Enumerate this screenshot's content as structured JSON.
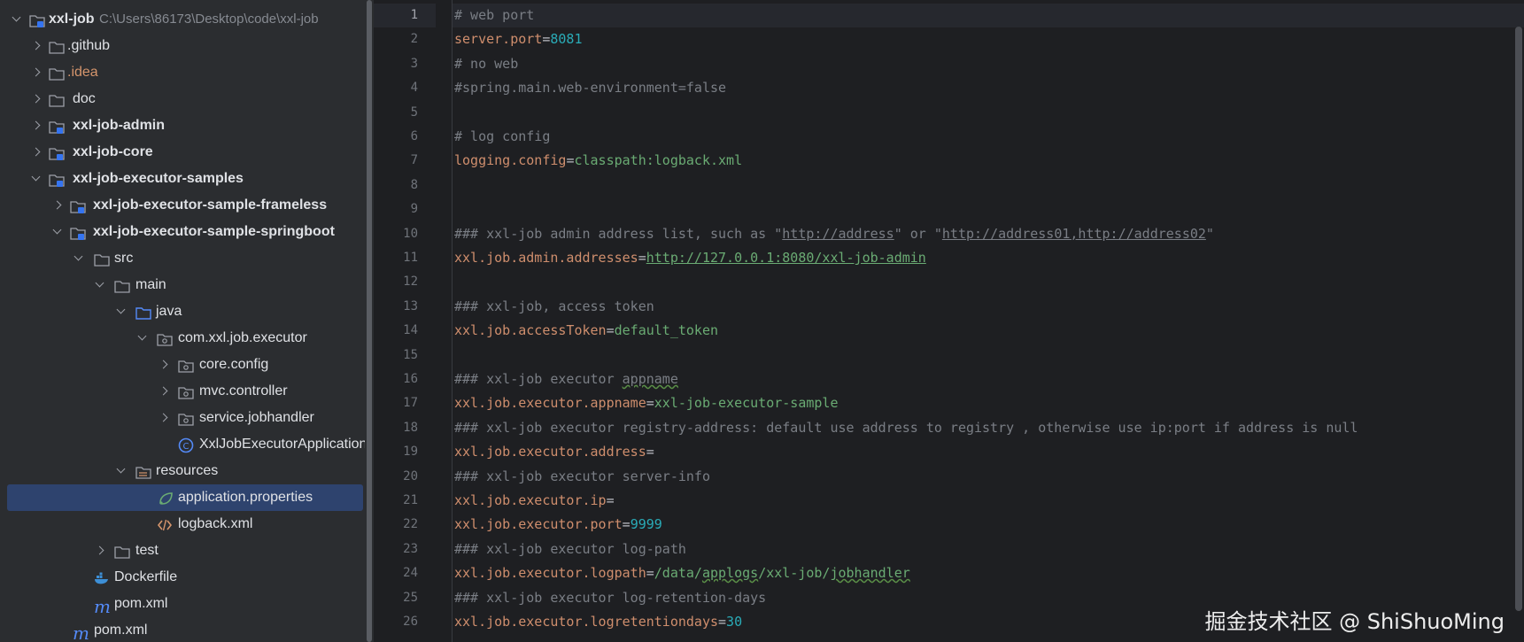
{
  "project_tree": {
    "root": {
      "name": "xxl-job",
      "path": "C:\\Users\\86173\\Desktop\\code\\xxl-job"
    },
    "items": [
      {
        "label": ".github"
      },
      {
        "label": ".idea"
      },
      {
        "label": "doc"
      },
      {
        "label": "xxl-job-admin"
      },
      {
        "label": "xxl-job-core"
      },
      {
        "label": "xxl-job-executor-samples"
      },
      {
        "label": "xxl-job-executor-sample-frameless"
      },
      {
        "label": "xxl-job-executor-sample-springboot"
      },
      {
        "label": "src"
      },
      {
        "label": "main"
      },
      {
        "label": "java"
      },
      {
        "label": "com.xxl.job.executor"
      },
      {
        "label": "core.config"
      },
      {
        "label": "mvc.controller"
      },
      {
        "label": "service.jobhandler"
      },
      {
        "label": "XxlJobExecutorApplication"
      },
      {
        "label": "resources"
      },
      {
        "label": "application.properties"
      },
      {
        "label": "logback.xml"
      },
      {
        "label": "test"
      },
      {
        "label": "Dockerfile"
      },
      {
        "label": "pom.xml"
      },
      {
        "label": "pom.xml"
      }
    ]
  },
  "editor": {
    "line_numbers": [
      "1",
      "2",
      "3",
      "4",
      "5",
      "6",
      "7",
      "8",
      "9",
      "10",
      "11",
      "12",
      "13",
      "14",
      "15",
      "16",
      "17",
      "18",
      "19",
      "20",
      "21",
      "22",
      "23",
      "24",
      "25",
      "26"
    ],
    "lines": {
      "l1": "# web port",
      "l2_key": "server.port",
      "l2_val": "8081",
      "l3": "# no web",
      "l4": "#spring.main.web-environment=false",
      "l6": "# log config",
      "l7_key": "logging.config",
      "l7_val": "classpath:logback.xml",
      "l10_a": "### xxl-job admin address list, such as \"",
      "l10_u1": "http://address",
      "l10_b": "\" or \"",
      "l10_u2": "http://address01,http://address02",
      "l10_c": "\"",
      "l11_key": "xxl.job.admin.addresses",
      "l11_val": "http://127.0.0.1:8080/xxl-job-admin",
      "l13": "### xxl-job, access token",
      "l14_key": "xxl.job.accessToken",
      "l14_val": "default_token",
      "l16_a": "### xxl-job executor ",
      "l16_b": "appname",
      "l17_key": "xxl.job.executor.appname",
      "l17_val": "xxl-job-executor-sample",
      "l18": "### xxl-job executor registry-address: default use address to registry , otherwise use ip:port if address is null",
      "l19_key": "xxl.job.executor.address",
      "l20": "### xxl-job executor server-info",
      "l21_key": "xxl.job.executor.ip",
      "l22_key": "xxl.job.executor.port",
      "l22_val": "9999",
      "l23": "### xxl-job executor log-path",
      "l24_key": "xxl.job.executor.logpath",
      "l24_val_a": "/data/",
      "l24_val_b": "applogs",
      "l24_val_c": "/xxl-job/",
      "l24_val_d": "jobhandler",
      "l25": "### xxl-job executor log-retention-days",
      "l26_key": "xxl.job.executor.logretentiondays",
      "l26_val": "30"
    }
  },
  "watermark": "掘金技术社区 @ ShiShuoMing",
  "colors": {
    "selection": "#2e436e",
    "bg": "#1e1f22",
    "panel": "#2b2d30",
    "key": "#cf8e6d",
    "string": "#6aab73",
    "number": "#2aacb8",
    "comment": "#7a7e85"
  }
}
